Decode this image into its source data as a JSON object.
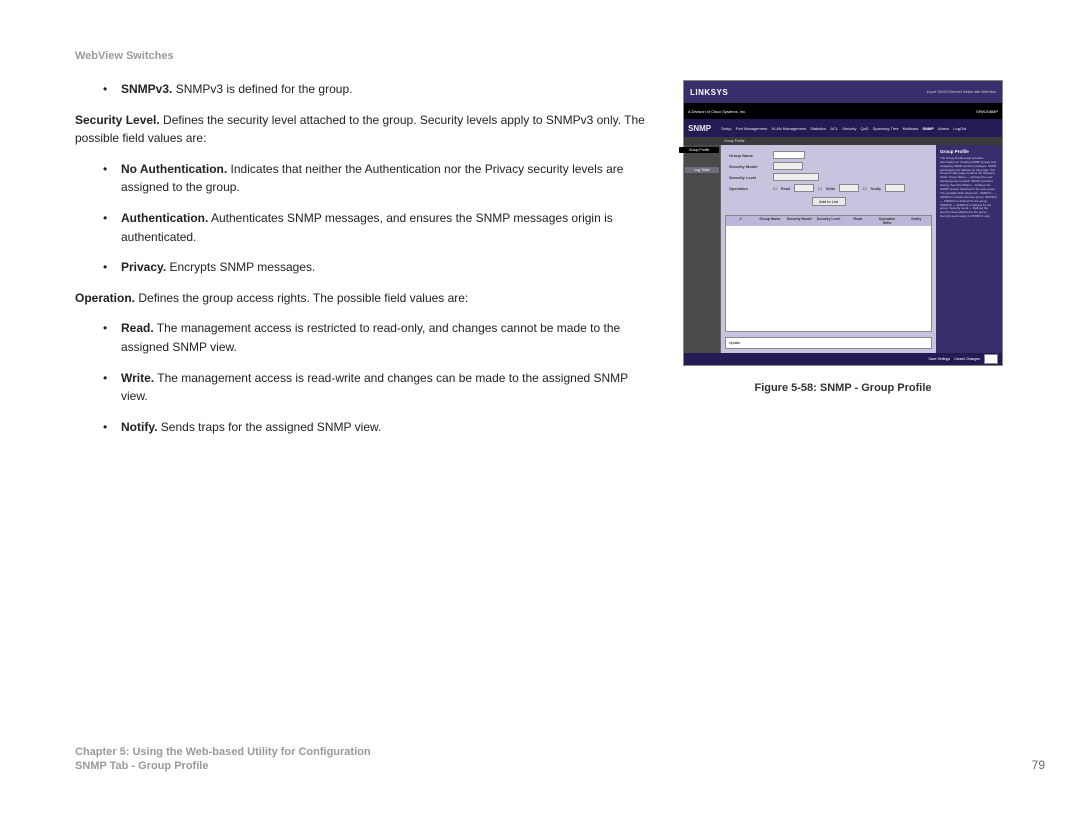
{
  "header": "WebView Switches",
  "body": {
    "bullet1": {
      "term": "SNMPv3.",
      "text": " SNMPv3 is defined for the group."
    },
    "sec_level": {
      "term": "Security Level.",
      "text": " Defines the security level attached to the group. Security levels apply to SNMPv3 only. The possible field values are:"
    },
    "noauth": {
      "term": "No Authentication.",
      "text": " Indicates that neither the Authentication nor the Privacy security levels are assigned to the group."
    },
    "auth": {
      "term": "Authentication.",
      "text": " Authenticates SNMP messages, and ensures the SNMP messages origin is authenticated."
    },
    "priv": {
      "term": "Privacy.",
      "text": " Encrypts SNMP messages."
    },
    "oper": {
      "term": "Operation.",
      "text": " Defines the group access rights. The possible field values are:"
    },
    "read": {
      "term": "Read.",
      "text": " The management access is restricted to read-only, and changes cannot be made to the assigned SNMP view."
    },
    "write": {
      "term": "Write.",
      "text": " The management access is read-write and changes can be made to the assigned SNMP view."
    },
    "notify": {
      "term": "Notify.",
      "text": " Sends traps for the assigned SNMP view."
    }
  },
  "figure": {
    "caption": "Figure 5-58: SNMP - Group Profile",
    "brand": "LINKSYS",
    "product_right": "8-port 10/100 Ethernet Switch with WebView",
    "main_tab": "SNMP",
    "tabs": [
      "Setup",
      "Port Management",
      "VLAN Management",
      "Statistics",
      "ACL",
      "Security",
      "QoS",
      "Spanning Tree",
      "Multicast",
      "SNMP",
      "Admin",
      "LogOut"
    ],
    "subtab": "Group Profile",
    "side_active": "Group Profile",
    "side_log": "Log Table",
    "form": {
      "group_name": "Group Name",
      "security_model": "Security Model",
      "security_level": "Security Level",
      "operation": "Operation",
      "read_lbl": "Read",
      "write_lbl": "Write",
      "notify_lbl": "Notify",
      "add_btn": "Add to List"
    },
    "update_btn": "Update",
    "table_headers": [
      "#",
      "Group Name",
      "Security Model",
      "Security Level",
      "Read",
      "Operation Write",
      "Notify"
    ],
    "help_title": "Group Profile",
    "help_text": "The Group Profile page provides information for creating SNMP groups and Assigning SNMP access privileges. SNMP parameters are defined on this page.\nThe Group Profile page contains the following fields:\nGroup Name — Defines the user-defined group to which SNMP members belong.\nSecurity Model — Defines the SNMP version attached to the user group. The possible field values are:\nSNMPv1 — SNMPv1 is defined for the group.\nSNMPv2 — SNMPv2 is defined for the group.\nSNMPv3 — SNMPv3 is defined for the group.\nSecurity Level — Defines the security level attached to the group. Security levels apply to SNMPv3 only.",
    "footer": [
      "Save Settings",
      "Cancel Changes"
    ]
  },
  "footer": {
    "chapter": "Chapter 5: Using the Web-based Utility for Configuration",
    "section": "SNMP Tab - Group Profile",
    "page": "79"
  },
  "bullet": "•"
}
